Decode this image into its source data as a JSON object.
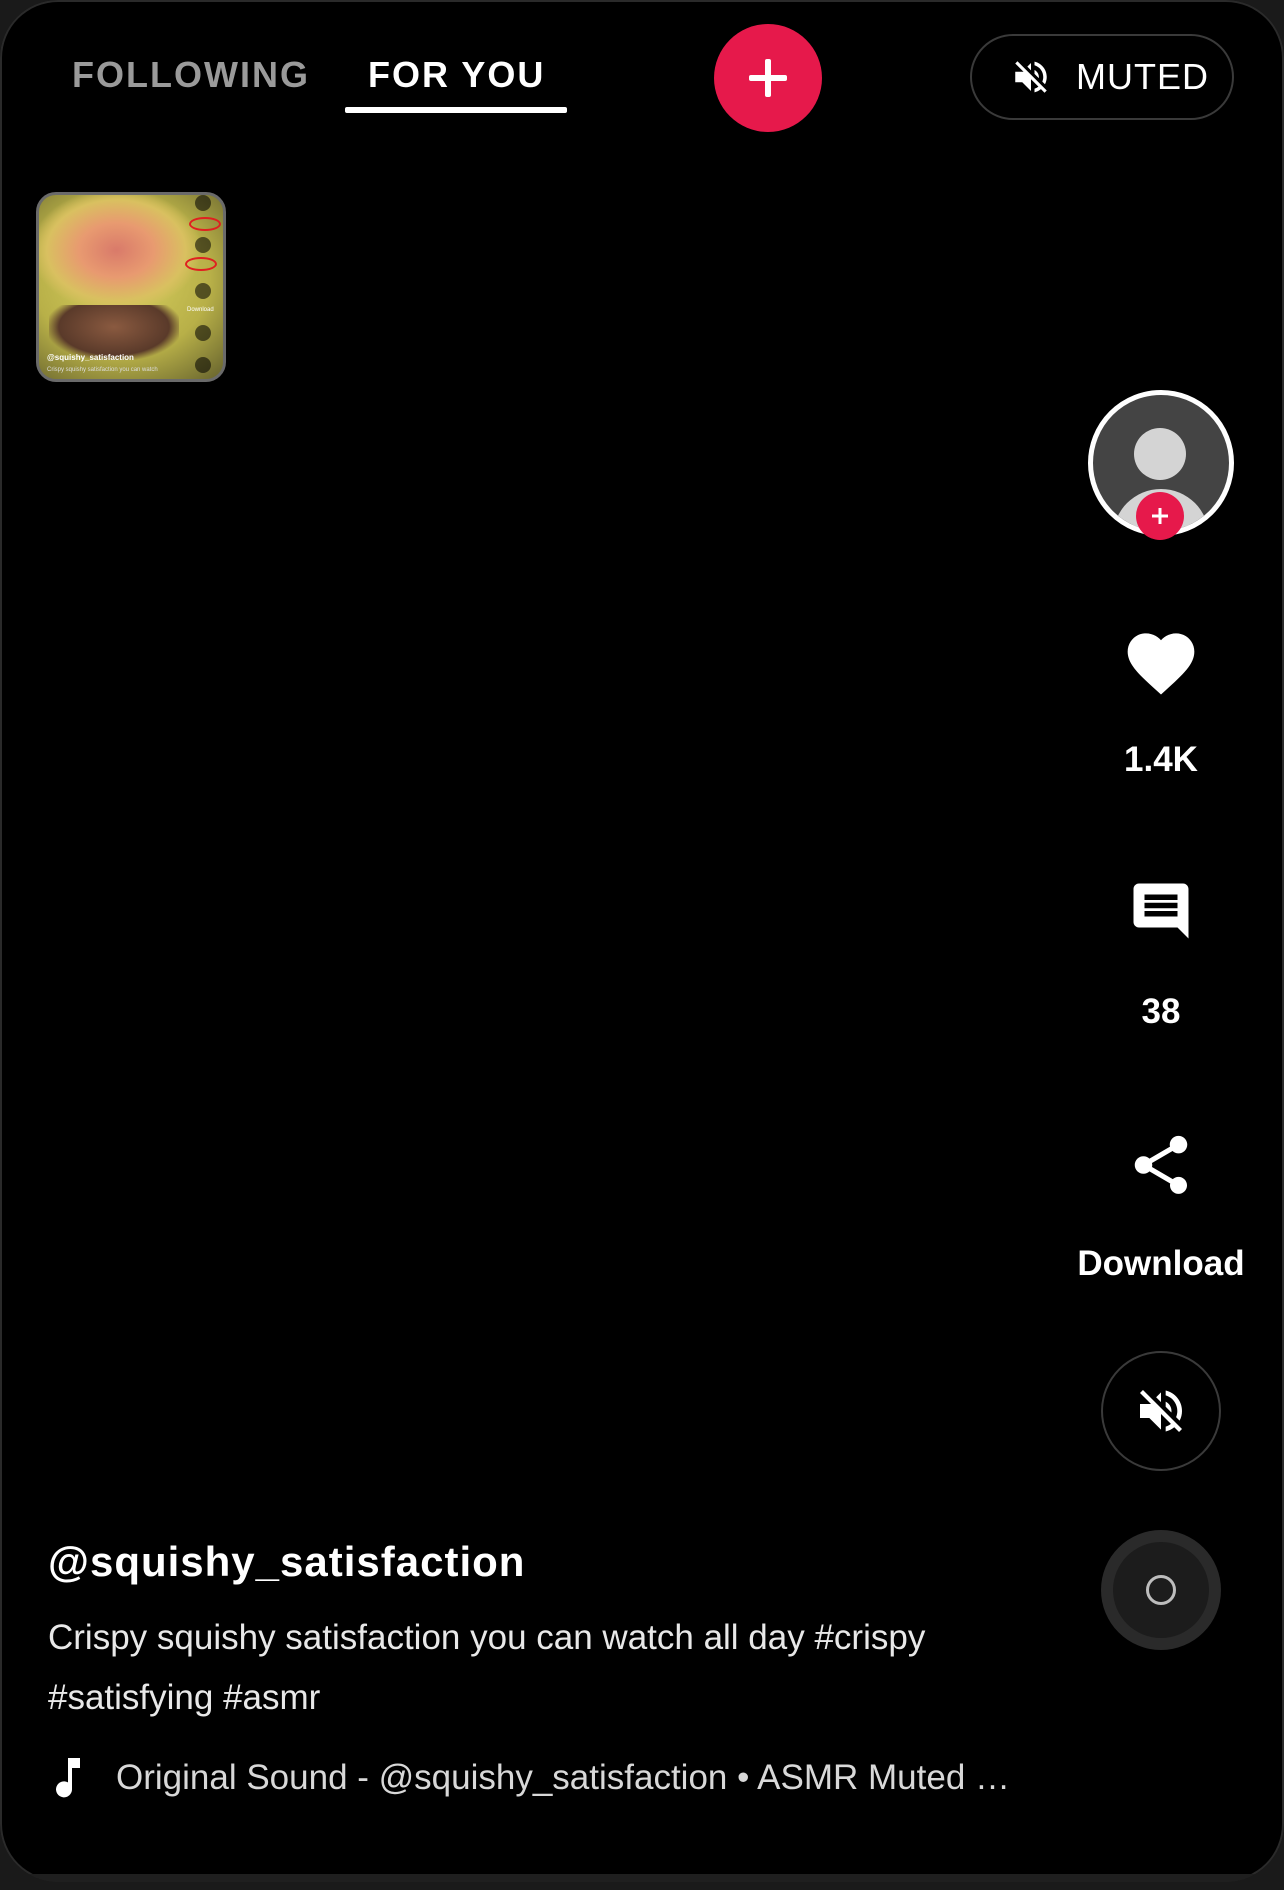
{
  "top_bar": {
    "tab_following": "FOLLOWING",
    "tab_for_you": "FOR YOU",
    "active_tab": "FOR YOU",
    "muted_label": "MUTED"
  },
  "preview": {
    "username": "@squishy_satisfaction",
    "caption": "Crispy squishy satisfaction you can watch",
    "download_label": "Download"
  },
  "actions": {
    "likes": "1.4K",
    "comments": "38",
    "download_label": "Download"
  },
  "post": {
    "username": "@squishy_satisfaction",
    "caption": "Crispy squishy satisfaction you can watch all day #crispy #satisfying #asmr",
    "sound": "Original Sound - @squishy_satisfaction • ASMR Muted …"
  },
  "icons": {
    "create": "plus-icon",
    "mute": "speaker-muted-icon",
    "like": "heart-icon",
    "comment": "comment-icon",
    "share": "share-icon",
    "music": "music-note-icon",
    "disc": "music-disc-icon"
  },
  "colors": {
    "background": "#000000",
    "accent": "#e6194b",
    "text": "#ffffff",
    "inactive_tab": "#9a9a9a"
  }
}
